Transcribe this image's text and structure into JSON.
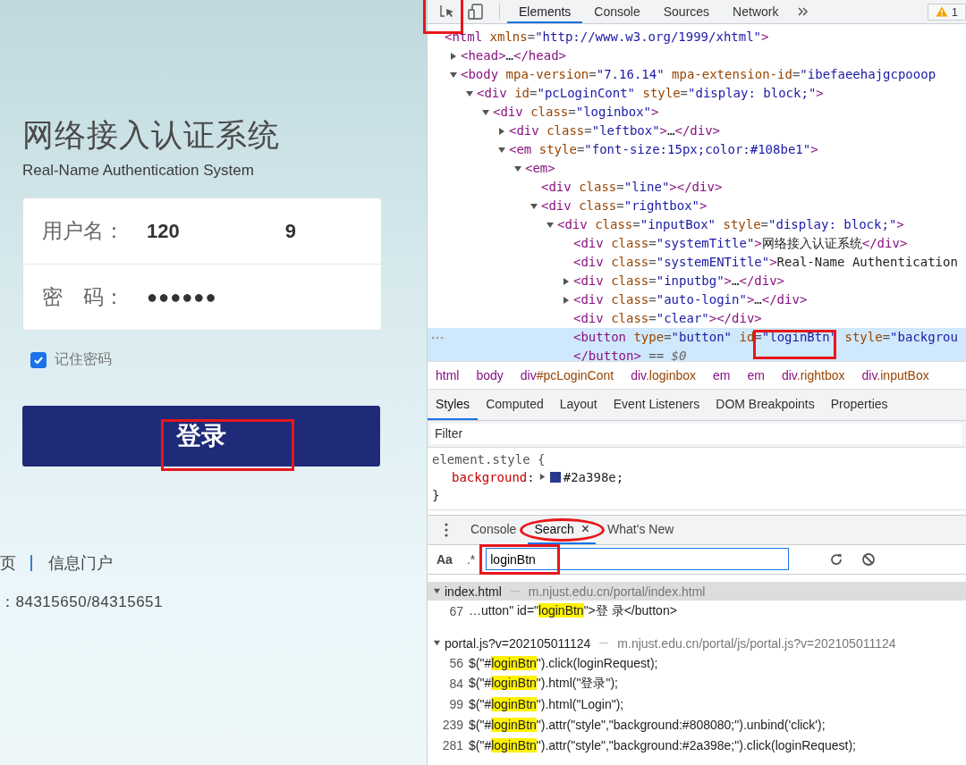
{
  "login_page": {
    "title": "网络接入认证系统",
    "subtitle": "Real-Name Authentication System",
    "username_label": "用户名：",
    "username_fragments": [
      "120",
      "9"
    ],
    "password_label": "密　码：",
    "password_value": "●●●●●●",
    "remember": {
      "label": "记住密码",
      "checked": true
    },
    "login_button": "登录",
    "footer_links": [
      "页",
      "信息门户"
    ],
    "phone": "：84315650/84315651"
  },
  "devtools": {
    "main_tabs": [
      {
        "label": "Elements",
        "selected": true
      },
      {
        "label": "Console",
        "selected": false
      },
      {
        "label": "Sources",
        "selected": false
      },
      {
        "label": "Network",
        "selected": false
      }
    ],
    "warning_count": "1",
    "dom_tree": [
      {
        "selected": false,
        "parts": [
          {
            "kind": "tag",
            "text": "<html"
          },
          {
            "kind": "attr",
            "text": " xmlns"
          },
          {
            "kind": "punct",
            "text": "="
          },
          {
            "kind": "value",
            "text": "\"http://www.w3.org/1999/xhtml\""
          },
          {
            "kind": "tag",
            "text": ">"
          }
        ],
        "children": [
          {
            "selected": false,
            "expanded": false,
            "parts": [
              {
                "kind": "tag",
                "text": "<head>"
              },
              {
                "kind": "text",
                "text": "…"
              },
              {
                "kind": "tag",
                "text": "</head>"
              }
            ]
          },
          {
            "selected": false,
            "expanded": true,
            "parts": [
              {
                "kind": "tag",
                "text": "<body"
              },
              {
                "kind": "attr",
                "text": " mpa-version"
              },
              {
                "kind": "punct",
                "text": "="
              },
              {
                "kind": "value",
                "text": "\"7.16.14\""
              },
              {
                "kind": "attr",
                "text": " mpa-extension-id"
              },
              {
                "kind": "punct",
                "text": "="
              },
              {
                "kind": "value",
                "text": "\"ibefaeehajgcpooop"
              }
            ],
            "children": [
              {
                "selected": false,
                "expanded": true,
                "parts": [
                  {
                    "kind": "tag",
                    "text": "<div"
                  },
                  {
                    "kind": "attr",
                    "text": " id"
                  },
                  {
                    "kind": "punct",
                    "text": "="
                  },
                  {
                    "kind": "value",
                    "text": "\"pcLoginCont\""
                  },
                  {
                    "kind": "attr",
                    "text": " style"
                  },
                  {
                    "kind": "punct",
                    "text": "="
                  },
                  {
                    "kind": "value",
                    "text": "\"display: block;\""
                  },
                  {
                    "kind": "tag",
                    "text": ">"
                  }
                ],
                "children": [
                  {
                    "selected": false,
                    "expanded": true,
                    "parts": [
                      {
                        "kind": "tag",
                        "text": "<div"
                      },
                      {
                        "kind": "attr",
                        "text": " class"
                      },
                      {
                        "kind": "punct",
                        "text": "="
                      },
                      {
                        "kind": "value",
                        "text": "\"loginbox\""
                      },
                      {
                        "kind": "tag",
                        "text": ">"
                      }
                    ],
                    "children": [
                      {
                        "selected": false,
                        "expanded": false,
                        "parts": [
                          {
                            "kind": "tag",
                            "text": "<div"
                          },
                          {
                            "kind": "attr",
                            "text": " class"
                          },
                          {
                            "kind": "punct",
                            "text": "="
                          },
                          {
                            "kind": "value",
                            "text": "\"leftbox\""
                          },
                          {
                            "kind": "tag",
                            "text": ">"
                          },
                          {
                            "kind": "text",
                            "text": "…"
                          },
                          {
                            "kind": "tag",
                            "text": "</div>"
                          }
                        ]
                      },
                      {
                        "selected": false,
                        "expanded": true,
                        "parts": [
                          {
                            "kind": "tag",
                            "text": "<em"
                          },
                          {
                            "kind": "attr",
                            "text": " style"
                          },
                          {
                            "kind": "punct",
                            "text": "="
                          },
                          {
                            "kind": "value",
                            "text": "\"font-size:15px;color:#108be1\""
                          },
                          {
                            "kind": "tag",
                            "text": ">"
                          }
                        ],
                        "children": [
                          {
                            "selected": false,
                            "expanded": true,
                            "parts": [
                              {
                                "kind": "tag",
                                "text": "<em>"
                              }
                            ],
                            "children": [
                              {
                                "selected": false,
                                "parts": [
                                  {
                                    "kind": "tag",
                                    "text": "<div"
                                  },
                                  {
                                    "kind": "attr",
                                    "text": " class"
                                  },
                                  {
                                    "kind": "punct",
                                    "text": "="
                                  },
                                  {
                                    "kind": "value",
                                    "text": "\"line\""
                                  },
                                  {
                                    "kind": "tag",
                                    "text": "></div>"
                                  }
                                ]
                              },
                              {
                                "selected": false,
                                "expanded": true,
                                "parts": [
                                  {
                                    "kind": "tag",
                                    "text": "<div"
                                  },
                                  {
                                    "kind": "attr",
                                    "text": " class"
                                  },
                                  {
                                    "kind": "punct",
                                    "text": "="
                                  },
                                  {
                                    "kind": "value",
                                    "text": "\"rightbox\""
                                  },
                                  {
                                    "kind": "tag",
                                    "text": ">"
                                  }
                                ],
                                "children": [
                                  {
                                    "selected": false,
                                    "expanded": true,
                                    "parts": [
                                      {
                                        "kind": "tag",
                                        "text": "<div"
                                      },
                                      {
                                        "kind": "attr",
                                        "text": " class"
                                      },
                                      {
                                        "kind": "punct",
                                        "text": "="
                                      },
                                      {
                                        "kind": "value",
                                        "text": "\"inputBox\""
                                      },
                                      {
                                        "kind": "attr",
                                        "text": " style"
                                      },
                                      {
                                        "kind": "punct",
                                        "text": "="
                                      },
                                      {
                                        "kind": "value",
                                        "text": "\"display: block;\""
                                      },
                                      {
                                        "kind": "tag",
                                        "text": ">"
                                      }
                                    ],
                                    "children": [
                                      {
                                        "selected": false,
                                        "parts": [
                                          {
                                            "kind": "tag",
                                            "text": "<div"
                                          },
                                          {
                                            "kind": "attr",
                                            "text": " class"
                                          },
                                          {
                                            "kind": "punct",
                                            "text": "="
                                          },
                                          {
                                            "kind": "value",
                                            "text": "\"systemTitle\""
                                          },
                                          {
                                            "kind": "tag",
                                            "text": ">"
                                          },
                                          {
                                            "kind": "text",
                                            "text": "网络接入认证系统"
                                          },
                                          {
                                            "kind": "tag",
                                            "text": "</div>"
                                          }
                                        ]
                                      },
                                      {
                                        "selected": false,
                                        "parts": [
                                          {
                                            "kind": "tag",
                                            "text": "<div"
                                          },
                                          {
                                            "kind": "attr",
                                            "text": " class"
                                          },
                                          {
                                            "kind": "punct",
                                            "text": "="
                                          },
                                          {
                                            "kind": "value",
                                            "text": "\"systemENTitle\""
                                          },
                                          {
                                            "kind": "tag",
                                            "text": ">"
                                          },
                                          {
                                            "kind": "text",
                                            "text": "Real-Name Authentication"
                                          }
                                        ]
                                      },
                                      {
                                        "selected": false,
                                        "expanded": false,
                                        "parts": [
                                          {
                                            "kind": "tag",
                                            "text": "<div"
                                          },
                                          {
                                            "kind": "attr",
                                            "text": " class"
                                          },
                                          {
                                            "kind": "punct",
                                            "text": "="
                                          },
                                          {
                                            "kind": "value",
                                            "text": "\"inputbg\""
                                          },
                                          {
                                            "kind": "tag",
                                            "text": ">"
                                          },
                                          {
                                            "kind": "text",
                                            "text": "…"
                                          },
                                          {
                                            "kind": "tag",
                                            "text": "</div>"
                                          }
                                        ]
                                      },
                                      {
                                        "selected": false,
                                        "expanded": false,
                                        "parts": [
                                          {
                                            "kind": "tag",
                                            "text": "<div"
                                          },
                                          {
                                            "kind": "attr",
                                            "text": " class"
                                          },
                                          {
                                            "kind": "punct",
                                            "text": "="
                                          },
                                          {
                                            "kind": "value",
                                            "text": "\"auto-login\""
                                          },
                                          {
                                            "kind": "tag",
                                            "text": ">"
                                          },
                                          {
                                            "kind": "text",
                                            "text": "…"
                                          },
                                          {
                                            "kind": "tag",
                                            "text": "</div>"
                                          }
                                        ]
                                      },
                                      {
                                        "selected": false,
                                        "parts": [
                                          {
                                            "kind": "tag",
                                            "text": "<div"
                                          },
                                          {
                                            "kind": "attr",
                                            "text": " class"
                                          },
                                          {
                                            "kind": "punct",
                                            "text": "="
                                          },
                                          {
                                            "kind": "value",
                                            "text": "\"clear\""
                                          },
                                          {
                                            "kind": "tag",
                                            "text": "></div>"
                                          }
                                        ]
                                      },
                                      {
                                        "selected": true,
                                        "parts": [
                                          {
                                            "kind": "tag",
                                            "text": "<button"
                                          },
                                          {
                                            "kind": "attr",
                                            "text": " type"
                                          },
                                          {
                                            "kind": "punct",
                                            "text": "="
                                          },
                                          {
                                            "kind": "value",
                                            "text": "\"button\""
                                          },
                                          {
                                            "kind": "attr",
                                            "text": " id"
                                          },
                                          {
                                            "kind": "punct",
                                            "text": "="
                                          },
                                          {
                                            "kind": "value",
                                            "text": "\"loginBtn\""
                                          },
                                          {
                                            "kind": "attr",
                                            "text": " style"
                                          },
                                          {
                                            "kind": "punct",
                                            "text": "="
                                          },
                                          {
                                            "kind": "value",
                                            "text": "\"backgrou"
                                          }
                                        ],
                                        "tail": [
                                          {
                                            "kind": "tag",
                                            "text": "</button>"
                                          },
                                          {
                                            "kind": "punct",
                                            "text": " == "
                                          },
                                          {
                                            "kind": "ref",
                                            "text": "$0"
                                          }
                                        ]
                                      }
                                    ]
                                  }
                                ]
                              }
                            ]
                          }
                        ]
                      }
                    ]
                  }
                ]
              }
            ]
          }
        ]
      }
    ],
    "breadcrumbs": [
      {
        "tag": "html"
      },
      {
        "tag": "body"
      },
      {
        "tag": "div",
        "qualifier": "#pcLoginCont"
      },
      {
        "tag": "div",
        "qualifier": ".loginbox"
      },
      {
        "tag": "em"
      },
      {
        "tag": "em"
      },
      {
        "tag": "div",
        "qualifier": ".rightbox"
      },
      {
        "tag": "div",
        "qualifier": ".inputBox"
      }
    ],
    "style_tabs": [
      {
        "label": "Styles",
        "selected": true
      },
      {
        "label": "Computed",
        "selected": false
      },
      {
        "label": "Layout",
        "selected": false
      },
      {
        "label": "Event Listeners",
        "selected": false
      },
      {
        "label": "DOM Breakpoints",
        "selected": false
      },
      {
        "label": "Properties",
        "selected": false
      }
    ],
    "filter_placeholder": "Filter",
    "element_style": {
      "selector": "element.style {",
      "property": "background",
      "colon": ":",
      "value": "#2a398e",
      "semicolon": ";",
      "close": "}"
    },
    "drawer_tabs": [
      {
        "label": "Console",
        "selected": false,
        "closable": false
      },
      {
        "label": "Search",
        "selected": true,
        "closable": true
      },
      {
        "label": "What's New",
        "selected": false,
        "closable": false
      }
    ],
    "close_glyph": "×",
    "search": {
      "case_toggle": "Aa",
      "regex_toggle": ".*",
      "value": "loginBtn"
    },
    "results": [
      {
        "file": "index.html",
        "path": "m.njust.edu.cn/portal/index.html",
        "expanded": true,
        "rows": [
          {
            "line": "67",
            "before": "…utton\" id=\"",
            "match": "loginBtn",
            "after": "\">登 录</button>"
          }
        ]
      },
      {
        "file": "portal.js?v=202105011124",
        "path": "m.njust.edu.cn/portal/js/portal.js?v=202105011124",
        "expanded": true,
        "rows": [
          {
            "line": "56",
            "before": "$(\"#",
            "match": "loginBtn",
            "after": "\").click(loginRequest);"
          },
          {
            "line": "84",
            "before": "$(\"#",
            "match": "loginBtn",
            "after": "\").html(\"登录\");"
          },
          {
            "line": "99",
            "before": "$(\"#",
            "match": "loginBtn",
            "after": "\").html(\"Login\");"
          },
          {
            "line": "239",
            "before": "$(\"#",
            "match": "loginBtn",
            "after": "\").attr(\"style\",\"background:#808080;\").unbind('click');"
          },
          {
            "line": "281",
            "before": "$(\"#",
            "match": "loginBtn",
            "after": "\").attr(\"style\",\"background:#2a398e;\").click(loginRequest);"
          }
        ]
      }
    ]
  }
}
